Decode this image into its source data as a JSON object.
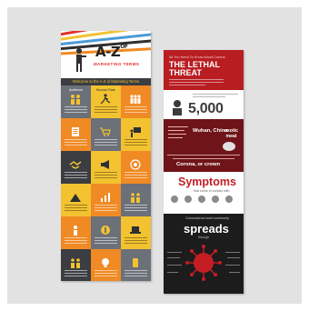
{
  "left_infographic": {
    "title": "A-Z",
    "title_suffix": "OF",
    "subtitle": "MARKETING TERMS",
    "band_text": "Welcome to the A-Z of Marketing Terms",
    "cells": [
      {
        "label": "Audience"
      },
      {
        "label": "Bounce Rate"
      },
      {
        "label": ""
      },
      {
        "label": ""
      },
      {
        "label": ""
      },
      {
        "label": ""
      },
      {
        "label": ""
      },
      {
        "label": ""
      },
      {
        "label": ""
      },
      {
        "label": ""
      },
      {
        "label": ""
      },
      {
        "label": ""
      },
      {
        "label": ""
      },
      {
        "label": ""
      },
      {
        "label": ""
      },
      {
        "label": ""
      },
      {
        "label": ""
      },
      {
        "label": ""
      }
    ]
  },
  "right_infographic": {
    "kicker": "All You Need To Know About Corona",
    "title_line1": "THE LETHAL",
    "title_line2": "THREAT",
    "big_number": "5,000",
    "location": "Wuhan, China",
    "exotic": "exotic meat",
    "corona_line": "Corona, or crown",
    "symptoms_title": "Symptoms",
    "symptoms_sub": "that come in contact with",
    "spreads_kicker": "Coronavirus most commonly",
    "spreads_title": "spreads",
    "spreads_sub": "through"
  },
  "colors": {
    "yellow": "#f2c230",
    "orange": "#f08a24",
    "grey": "#6b7079",
    "dark": "#3a3d42",
    "red": "#c41d24",
    "darkred": "#6f1418"
  }
}
